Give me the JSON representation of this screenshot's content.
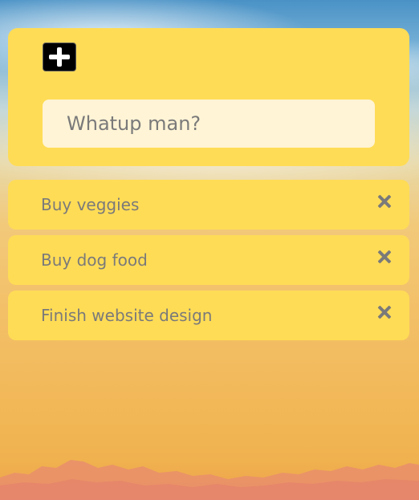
{
  "app": {
    "accent_color": "#ffdc56",
    "input_background": "#fff4d6"
  },
  "header": {
    "add_button_icon": "plus-icon",
    "input": {
      "placeholder": "Whatup man?",
      "value": ""
    }
  },
  "todos": [
    {
      "text": "Buy veggies",
      "delete_icon": "close-icon"
    },
    {
      "text": "Buy dog food",
      "delete_icon": "close-icon"
    },
    {
      "text": "Finish website design",
      "delete_icon": "close-icon"
    }
  ]
}
